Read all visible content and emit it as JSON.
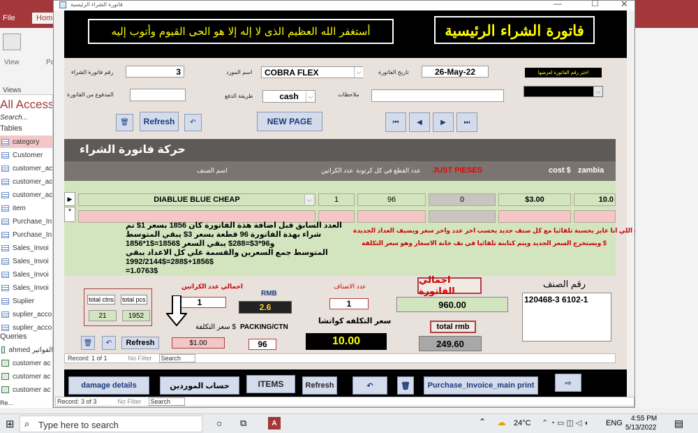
{
  "access": {
    "tabs": [
      "File",
      "Home"
    ],
    "ribbon_view_label": "View",
    "ribbon_views_group": "Views",
    "ribbon_pa_label": "Pa",
    "nav_title": "All Access",
    "nav_search": "Search...",
    "tables_group": "Tables",
    "tables": [
      "category",
      "Customer",
      "customer_ac",
      "customer_ac",
      "customer_ac",
      "item",
      "Purchase_In",
      "Purchase_In",
      "Sales_Invoi",
      "Sales_Invoi",
      "Sales_Invoi",
      "Sales_Invoi",
      "Suplier",
      "suplier_acco",
      "suplier_acco"
    ],
    "queries_group": "Queries",
    "queries": [
      "ahmed الفواتير",
      "customer ac",
      "customer ac",
      "customer ac"
    ],
    "status_left": "Re..."
  },
  "window": {
    "title": "فاتورة الشراء الرئيسية",
    "banner_main": "فاتورة الشراء الرئيسية",
    "banner_prayer": "أستغفر الله العظيم الذى لا إله إلا هو الحى القيوم وأتوب إليه"
  },
  "header": {
    "invoice_no_label": "رقم فاتورة الشراء",
    "invoice_no": "3",
    "supplier_label": "اسم المورد",
    "supplier": "COBRA FLEX",
    "date_label": "تاريخ الفاتورة",
    "date": "26-May-22",
    "choose_label": "اختر رقم الفاتورة لعرضها",
    "paid_label": "المدفوع من الفاتورة",
    "payment_label": "طريقة الدفع",
    "payment": "cash",
    "notes_label": "ملاحظات",
    "refresh": "Refresh",
    "new_page": "NEW PAGE"
  },
  "subform": {
    "title": "حركة فاتورة الشراء",
    "col_item_name": "اسم الصنف",
    "col_cartons": "عدد الكراتين",
    "col_pieces_per_carton": "عدد القطع في كل كرتونة",
    "col_just_pieces": "JUST PIESES",
    "col_cost": "cost $",
    "col_zambia": "zambia",
    "row1": {
      "item": "DIABLUE BLUE CHEAP",
      "cartons": "1",
      "pieces": "96",
      "just": "0",
      "cost": "$3.00",
      "zambia": "10.0"
    },
    "note_lines": [
      "العدد السابق قبل اضافة هذة الفاتورة كان 1856 بسعر 1$ تم",
      "شراء بهذة الفاتورة 96 قطعة بسعر 3$ يبقي المتوسط",
      "1856*1$=1856$ و96*3$=288$ يبقي السعر",
      "المتوسط جمع السعرين والقسمة علي كل الاعداد يبقي",
      "1992/2144$=288$+1856$",
      "=1.0763$"
    ],
    "red_note_1": "دة اللي انا عايز يحسبة تلقائيا مع كل صنف جديد يحسب اخر عدد واخر سعر ويضيف العداد الجديدة",
    "red_note_2": "ويستخرج السعر الجديد ويتم كتابتة تلقائيا في نف خانة الاسعار وهو سعر التكلفة $",
    "total_ctns_label": "total ctns",
    "total_pcs_label": "total pcs",
    "total_ctns": "21",
    "total_pcs": "1952",
    "total_cartons_label": "اجمالي عدد الكراتين",
    "total_cartons": "1",
    "rmb_label": "RMB",
    "rmb": "2.6",
    "items_count_label": "عدد الاصناف",
    "items_count": "1",
    "invoice_total_label": "اجمالي الفاتورة",
    "invoice_total": "960.00",
    "item_no_label": "رقم الصنف",
    "item_no": "120468-3 6102-1",
    "cost_price_label": "سعر التكلفة $",
    "cost_price": "$1.00",
    "packing_label": "PACKING/CTN",
    "packing": "96",
    "cost_kwatsha_label": "سعر التكلفه كواتشا",
    "cost_kwatsha": "10.00",
    "total_rmb_label": "total rmb",
    "total_rmb": "249.60",
    "refresh": "Refresh",
    "record_nav": "Record:  1 of 1",
    "no_filter": "No Filter",
    "search": "Search"
  },
  "footer_buttons": {
    "damage": "damage details",
    "suppliers_account": "حساب الموردين",
    "items": "ITEMS",
    "refresh": "Refresh",
    "print": "Purchase_Invoice_main print"
  },
  "main_record_nav": "Record:  3 of 3",
  "main_no_filter": "No Filter",
  "main_search": "Search",
  "taskbar": {
    "search_placeholder": "Type here to search",
    "weather": "24°C",
    "lang": "ENG",
    "time": "4:55 PM",
    "date": "5/13/2022"
  },
  "colors": {
    "access_red": "#a4373a",
    "banner_yellow": "#ffff00",
    "row_green": "#d3e5bf",
    "row_pink": "#f4c6c6",
    "kwatsha_yellow": "#ffff00"
  }
}
